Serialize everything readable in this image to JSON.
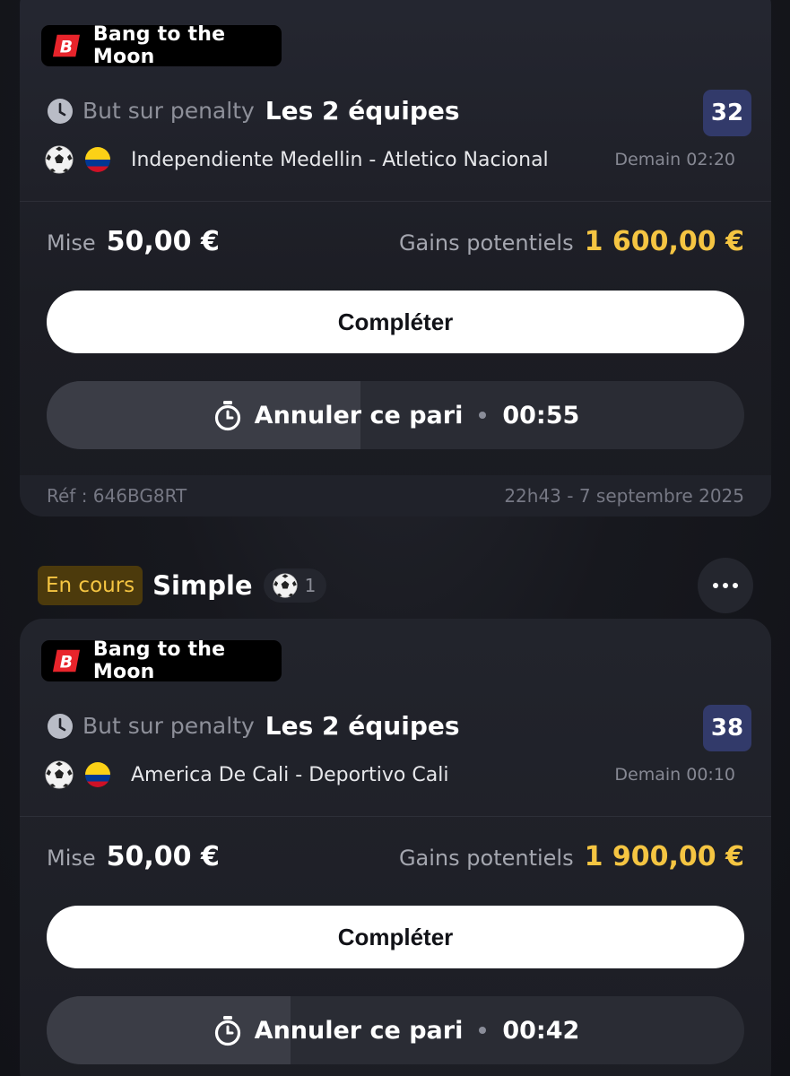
{
  "bets": [
    {
      "promo": "Bang to the Moon",
      "market_type": "But sur penalty",
      "market_choice": "Les 2 équipes",
      "odds": "32",
      "match": "Independiente Medellin - Atletico Nacional",
      "match_time": "Demain 02:20",
      "stake_label": "Mise",
      "stake": "50,00 €",
      "gains_label": "Gains potentiels",
      "gains": "1 600,00 €",
      "complete_label": "Compléter",
      "cancel_label": "Annuler ce pari",
      "cancel_timer": "00:55",
      "cancel_progress": 0.45,
      "ref": "Réf : 646BG8RT",
      "placed_at": "22h43 - 7 septembre 2025"
    },
    {
      "status": "En cours",
      "bet_type": "Simple",
      "selection_count": "1",
      "promo": "Bang to the Moon",
      "market_type": "But sur penalty",
      "market_choice": "Les 2 équipes",
      "odds": "38",
      "match": "America De Cali - Deportivo Cali",
      "match_time": "Demain 00:10",
      "stake_label": "Mise",
      "stake": "50,00 €",
      "gains_label": "Gains potentiels",
      "gains": "1 900,00 €",
      "complete_label": "Compléter",
      "cancel_label": "Annuler ce pari",
      "cancel_timer": "00:42",
      "cancel_progress": 0.35
    }
  ],
  "icons": {
    "promo": "bang-logo-icon",
    "market": "clock-icon",
    "sport": "soccer-ball-icon",
    "country": "colombia-flag-icon",
    "cancel": "stopwatch-icon",
    "more": "more-dots-icon"
  },
  "colors": {
    "accent_gold": "#f5c542",
    "odds_badge": "#323a6a",
    "promo_red": "#e8242b"
  }
}
